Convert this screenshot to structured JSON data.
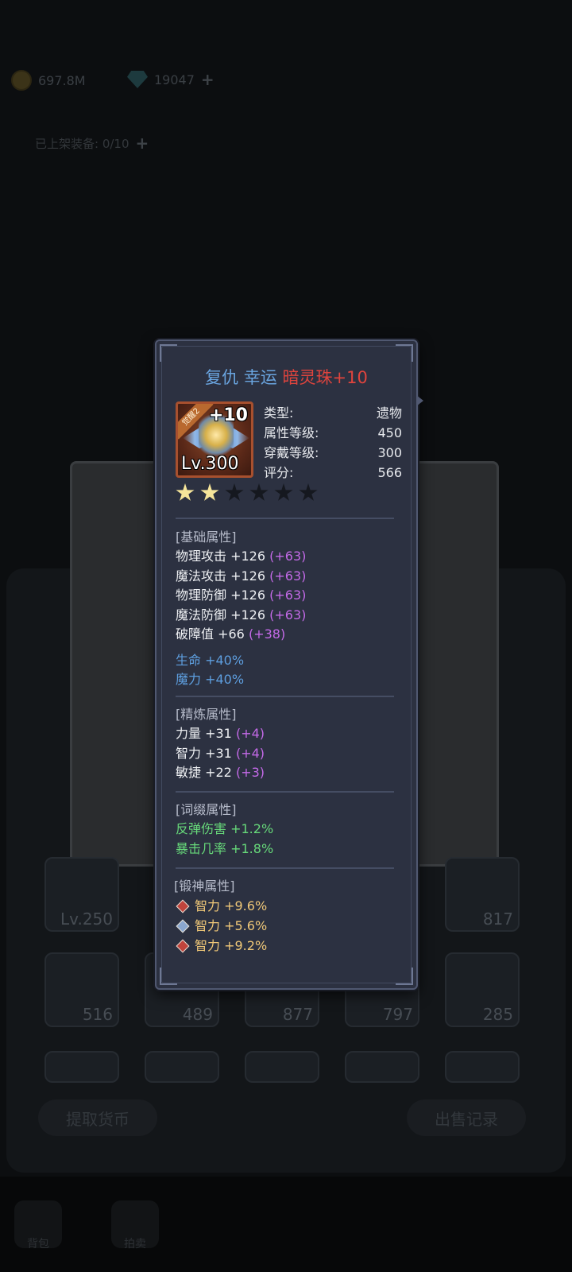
{
  "currency": {
    "gold": "697.8M",
    "gems": "19047",
    "add": "+"
  },
  "slots": {
    "label": "已上架装备: 0/10",
    "add": "+"
  },
  "grid": {
    "tiles": [
      {
        "num": "Lv.250"
      },
      {
        "num": "817"
      },
      {
        "num": "516"
      },
      {
        "num": "489"
      },
      {
        "num": "877"
      },
      {
        "num": "797"
      },
      {
        "num": "285"
      }
    ]
  },
  "buttons": {
    "withdraw": "提取货币",
    "sale_records": "出售记录"
  },
  "nav": {
    "left": "背包",
    "second": "拍卖"
  },
  "item": {
    "title_prefix": "复仇 幸运",
    "title_name": "暗灵珠+10",
    "badge": "觉醒2",
    "plus_level": "+10",
    "level": "Lv.300",
    "info": [
      {
        "label": "类型:",
        "value": "遗物"
      },
      {
        "label": "属性等级:",
        "value": "450"
      },
      {
        "label": "穿戴等级:",
        "value": "300"
      },
      {
        "label": "评分:",
        "value": "566"
      }
    ],
    "stars_filled": 2,
    "stars_total": 6,
    "base": {
      "header": "[基础属性]",
      "lines": [
        {
          "text": "物理攻击 +126",
          "bonus": "(+63)"
        },
        {
          "text": "魔法攻击 +126",
          "bonus": "(+63)"
        },
        {
          "text": "物理防御 +126",
          "bonus": "(+63)"
        },
        {
          "text": "魔法防御 +126",
          "bonus": "(+63)"
        },
        {
          "text": "破障值 +66",
          "bonus": "(+38)"
        }
      ],
      "extra": [
        "生命 +40%",
        "魔力 +40%"
      ]
    },
    "refine": {
      "header": "[精炼属性]",
      "lines": [
        {
          "text": "力量 +31",
          "bonus": "(+4)"
        },
        {
          "text": "智力 +31",
          "bonus": "(+4)"
        },
        {
          "text": "敏捷 +22",
          "bonus": "(+3)"
        }
      ]
    },
    "affix": {
      "header": "[词缀属性]",
      "lines": [
        "反弹伤害 +1.2%",
        "暴击几率 +1.8%"
      ]
    },
    "forge": {
      "header": "[锻神属性]",
      "lines": [
        {
          "gem": "red",
          "text": "智力 +9.6%"
        },
        {
          "gem": "blue",
          "text": "智力 +5.6%"
        },
        {
          "gem": "red",
          "text": "智力 +9.2%"
        }
      ]
    }
  },
  "colors": {
    "title_prefix": "#6aa5e0",
    "title_name": "#e0443d",
    "bonus": "#c46ae8",
    "percent_blue": "#5e9fe0",
    "affix_green": "#67d97a",
    "forge_gold": "#f0c878"
  }
}
